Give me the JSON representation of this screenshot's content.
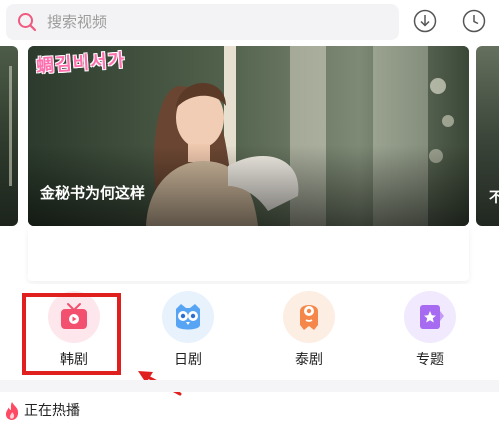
{
  "search": {
    "placeholder": "搜索视频",
    "icon": "search-icon"
  },
  "header_icons": [
    {
      "name": "download-icon"
    },
    {
      "name": "history-clock-icon"
    }
  ],
  "banner": {
    "current_title": "金秘书为何这样",
    "logo_text": "김비서가",
    "logo_prefix": "蜩",
    "next_peek_title": "不"
  },
  "categories": [
    {
      "label": "韩剧",
      "icon": "tv-icon",
      "color": "#f2506e",
      "bg": "#fde7ec"
    },
    {
      "label": "日剧",
      "icon": "owl-icon",
      "color": "#57a4f4",
      "bg": "#e8f2fd"
    },
    {
      "label": "泰剧",
      "icon": "mascot-icon",
      "color": "#f6874a",
      "bg": "#fdeee4"
    },
    {
      "label": "专题",
      "icon": "star-tag-icon",
      "color": "#a66bf1",
      "bg": "#f1e9fd"
    }
  ],
  "highlight": {
    "target": "韩剧",
    "color": "#e0201e"
  },
  "hot_section": {
    "title": "正在热播",
    "icon": "fire-icon",
    "icon_color": "#ff4a63"
  }
}
